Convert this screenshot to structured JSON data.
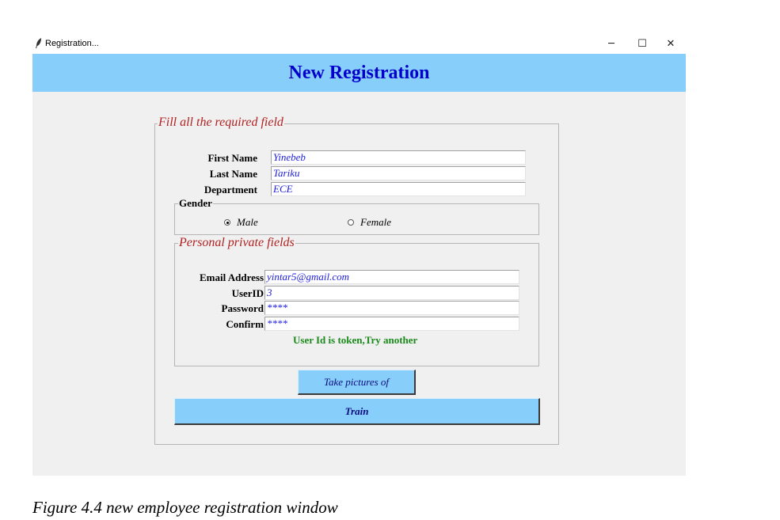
{
  "window": {
    "title": "Registration...",
    "minimize_glyph": "─",
    "maximize_glyph": "☐",
    "close_glyph": "✕"
  },
  "header": {
    "title": "New Registration"
  },
  "main_frame": {
    "legend": "Fill all the required field"
  },
  "fields": {
    "first_name": {
      "label": "First Name",
      "value": "Yinebeb"
    },
    "last_name": {
      "label": "Last Name",
      "value": "Tariku"
    },
    "department": {
      "label": "Department",
      "value": "ECE"
    }
  },
  "gender": {
    "legend": "Gender",
    "options": [
      {
        "label": "Male",
        "selected": true
      },
      {
        "label": "Female",
        "selected": false
      }
    ]
  },
  "private_frame": {
    "legend": "Personal private fields"
  },
  "private": {
    "email": {
      "label": "Email Address",
      "value": "yintar5@gmail.com"
    },
    "userid": {
      "label": "UserID",
      "value": "3"
    },
    "password": {
      "label": "Password",
      "value": "****"
    },
    "confirm": {
      "label": "Confirm",
      "value": "****"
    },
    "message": "User Id is token,Try another"
  },
  "buttons": {
    "take_pictures": "Take pictures of",
    "train": "Train"
  },
  "caption": "Figure 4.4 new employee registration window",
  "colors": {
    "header_bg": "#87cefa",
    "header_text": "#0000cd",
    "legend_red": "#b22222",
    "entry_text": "#2020e0",
    "message_green": "#1a8a1a",
    "button_bg": "#87cefa"
  }
}
